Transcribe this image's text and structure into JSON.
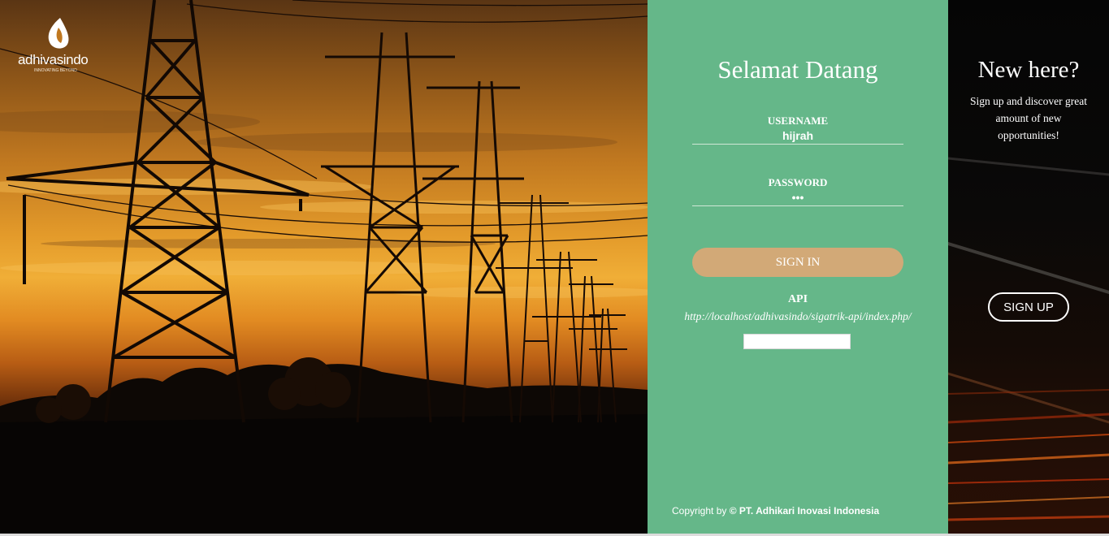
{
  "brand": {
    "name": "adhivasindo",
    "tagline": "INNOVATING BEYOND"
  },
  "login": {
    "title": "Selamat Datang",
    "username_label": "USERNAME",
    "username_value": "hijrah",
    "password_label": "PASSWORD",
    "password_value": "•••",
    "signin_label": "SIGN IN",
    "api_label": "API",
    "api_url": "http://localhost/adhivasindo/sigatrik-api/index.php/",
    "api_input_value": "",
    "copyright_prefix": "Copyright by",
    "copyright_company": "© PT. Adhikari Inovasi Indonesia"
  },
  "signup": {
    "title": "New here?",
    "text": "Sign up and discover great amount of new opportunities!",
    "button_label": "SIGN UP"
  },
  "colors": {
    "panel_green": "#65b789",
    "signin_button": "#d2a977",
    "side_dark": "#0a0908"
  },
  "icons": {
    "logo": "flame-leaf-logo-icon"
  }
}
